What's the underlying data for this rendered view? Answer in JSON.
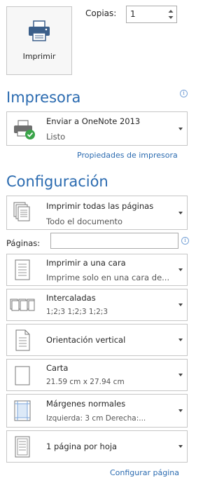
{
  "print": {
    "button_label": "Imprimir",
    "copies_label": "Copias:",
    "copies_value": "1"
  },
  "printer": {
    "section_title": "Impresora",
    "name": "Enviar a OneNote 2013",
    "status": "Listo",
    "properties_link": "Propiedades de impresora"
  },
  "settings": {
    "section_title": "Configuración",
    "pages_label": "Páginas:",
    "pages_value": "",
    "print_range": {
      "title": "Imprimir todas las páginas",
      "subtitle": "Todo el documento"
    },
    "sides": {
      "title": "Imprimir a una cara",
      "subtitle": "Imprime solo en una cara de..."
    },
    "collation": {
      "title": "Intercaladas",
      "subtitle": "1;2;3    1;2;3    1;2;3"
    },
    "orientation": {
      "title": "Orientación vertical"
    },
    "paper": {
      "title": "Carta",
      "subtitle": "21.59 cm x 27.94 cm"
    },
    "margins": {
      "title": "Márgenes normales",
      "subtitle": "Izquierda:  3 cm    Derecha:..."
    },
    "per_sheet": {
      "title": "1 página por hoja"
    },
    "page_setup_link": "Configurar página"
  },
  "colors": {
    "accent": "#2b6bb0",
    "ready_green": "#3aa449"
  }
}
